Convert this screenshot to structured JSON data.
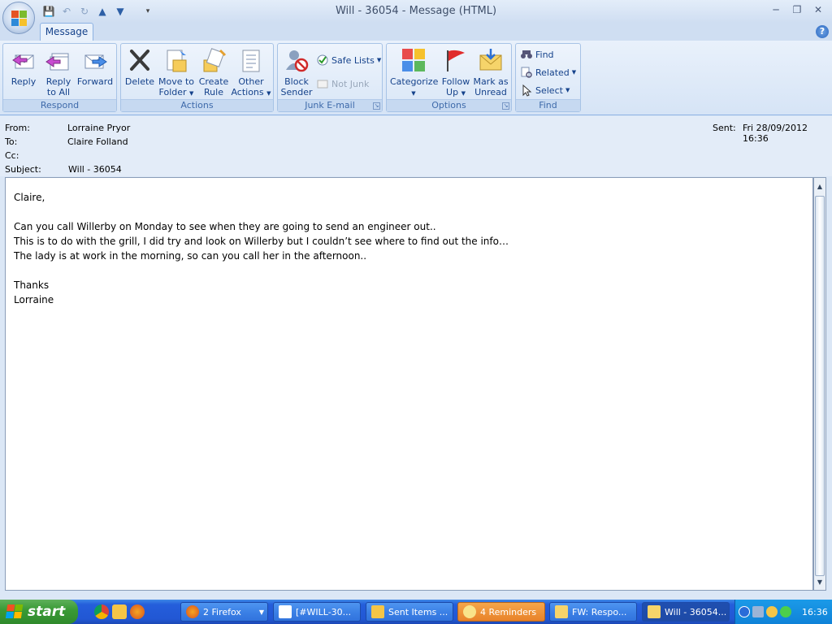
{
  "window": {
    "title": "Will - 36054 - Message (HTML)"
  },
  "tabs": [
    {
      "label": "Message"
    }
  ],
  "ribbon": {
    "groups": {
      "respond": {
        "label": "Respond",
        "reply": "Reply",
        "reply_all_1": "Reply",
        "reply_all_2": "to All",
        "forward": "Forward"
      },
      "actions": {
        "label": "Actions",
        "delete": "Delete",
        "move_1": "Move to",
        "move_2": "Folder",
        "create_1": "Create",
        "create_2": "Rule",
        "other_1": "Other",
        "other_2": "Actions"
      },
      "junk": {
        "label": "Junk E-mail",
        "block_1": "Block",
        "block_2": "Sender",
        "safe_lists": "Safe Lists",
        "not_junk": "Not Junk"
      },
      "options": {
        "label": "Options",
        "categorize": "Categorize",
        "follow_1": "Follow",
        "follow_2": "Up",
        "mark_1": "Mark as",
        "mark_2": "Unread"
      },
      "find": {
        "label": "Find",
        "find": "Find",
        "related": "Related",
        "select": "Select"
      }
    }
  },
  "message": {
    "from_label": "From:",
    "from": "Lorraine Pryor",
    "to_label": "To:",
    "to": "Claire Folland",
    "cc_label": "Cc:",
    "cc": "",
    "subject_label": "Subject:",
    "subject": "Will - 36054",
    "sent_label": "Sent:",
    "sent": "Fri 28/09/2012 16:36",
    "body_lines": [
      "Claire,",
      "",
      "Can you call Willerby on Monday to see when they are going to send an engineer out..",
      "This is to do with the grill, I did try and look on Willerby but I couldn’t see where to find out the info…",
      "The lady is at work in the morning, so can you call her in the afternoon..",
      "",
      "Thanks",
      "Lorraine"
    ]
  },
  "taskbar": {
    "start": "start",
    "tasks": [
      {
        "label": "2 Firefox"
      },
      {
        "label": "[#WILL-30..."
      },
      {
        "label": "Sent Items ..."
      },
      {
        "label": "4 Reminders"
      },
      {
        "label": "FW: Respo..."
      },
      {
        "label": "Will - 36054..."
      }
    ],
    "clock": "16:36"
  },
  "colors": {
    "ribbon_text": "#15428b",
    "taskbar_blue": "#245edb",
    "start_green": "#3a9b36",
    "reminder_orange": "#e8822a"
  }
}
